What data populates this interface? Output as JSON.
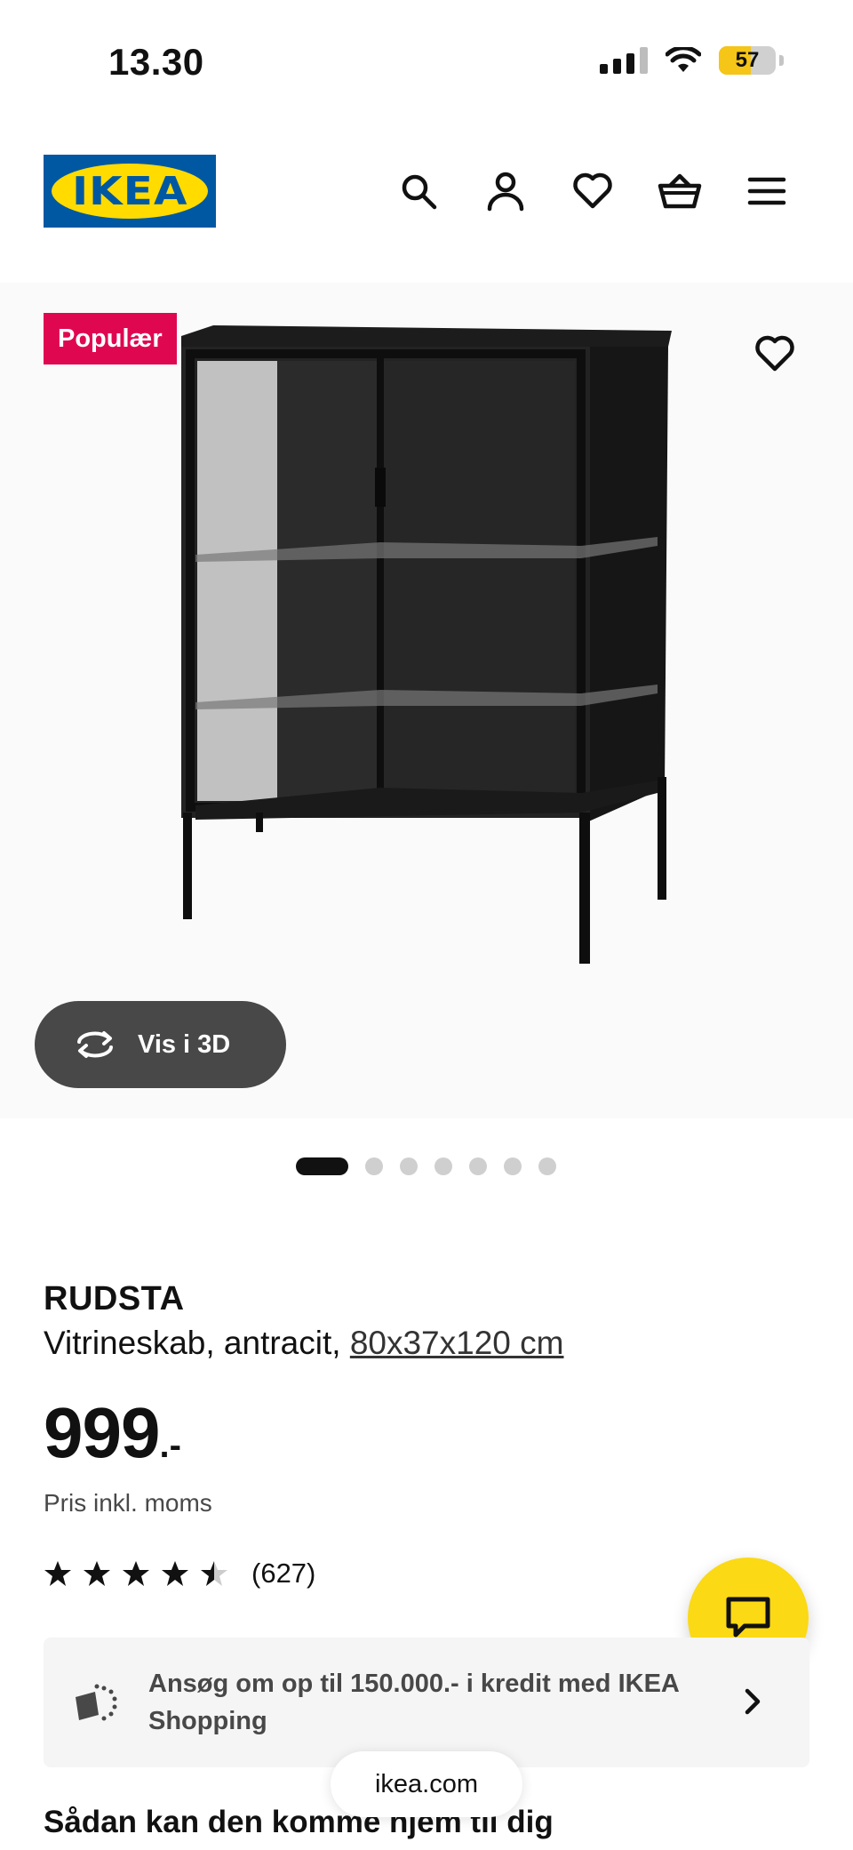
{
  "status_bar": {
    "time": "13.30",
    "battery": "57",
    "battery_level": 0.57
  },
  "header": {
    "logo_text": "IKEA",
    "icons": [
      "search-icon",
      "user-icon",
      "heart-icon",
      "basket-icon",
      "menu-icon"
    ]
  },
  "product_image": {
    "badge": "Populær",
    "view_3d_label": "Vis i 3D",
    "carousel_total": 7,
    "carousel_active_index": 0
  },
  "product": {
    "name": "RUDSTA",
    "description": "Vitrineskab, antracit,",
    "dimensions": "80x37x120 cm",
    "price": "999",
    "price_suffix": ".-",
    "price_note": "Pris inkl. moms",
    "rating_value": 4.5,
    "rating_max": 5,
    "rating_count": "(627)"
  },
  "credit_banner": {
    "text": "Ansøg om op til 150.000.- i kredit med IKEA Shopping"
  },
  "browser": {
    "url": "ikea.com"
  },
  "delivery": {
    "heading": "Sådan kan den komme hjem til dig"
  },
  "colors": {
    "ikea_blue": "#0058a3",
    "ikea_yellow": "#ffdb00",
    "badge_red": "#e00751",
    "chat_yellow": "#fbd914",
    "button_dark": "#484848"
  }
}
